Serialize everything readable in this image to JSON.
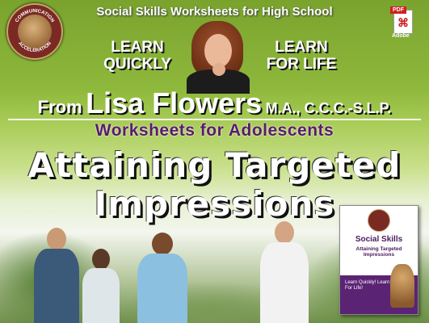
{
  "header": {
    "title": "Social Skills Worksheets for High School"
  },
  "logo": {
    "line1": "COMMUNICATION",
    "line2": "ACCELERATION"
  },
  "pdf_badge": {
    "tag": "PDF",
    "label": "Adobe",
    "color": "#d02020"
  },
  "taglines": {
    "left_line1": "LEARN",
    "left_line2": "QUICKLY",
    "right_line1": "LEARN",
    "right_line2": "FOR LIFE"
  },
  "author": {
    "prefix": "From",
    "name": "Lisa Flowers",
    "credentials": "M.A., C.C.C.-S.L.P."
  },
  "subtitle": "Worksheets for Adolescents",
  "headline": {
    "line1": "Attaining Targeted",
    "line2": "Impressions"
  },
  "book_cover": {
    "title": "Social Skills",
    "subtitle": "Attaining Targeted Impressions",
    "slogan": "Learn Quickly! Learn For Life!",
    "accent": "#5b2374"
  },
  "colors": {
    "brand_purple": "#5a1a6e",
    "logo_red": "#7a2a23",
    "background_green": "#7fa636"
  }
}
